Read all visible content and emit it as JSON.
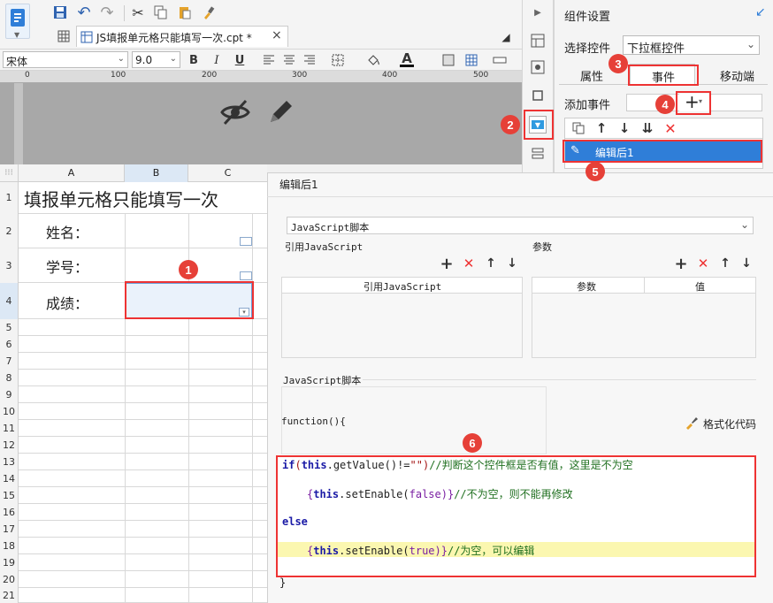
{
  "tab": {
    "title": "JS填报单元格只能填写一次.cpt *",
    "close": "×"
  },
  "font": {
    "family": "宋体",
    "size": "9.0"
  },
  "format_buttons": {
    "bold": "B",
    "italic": "I",
    "underline": "U"
  },
  "ruler": {
    "t0": "0",
    "t100": "100",
    "t200": "200",
    "t300": "300",
    "t400": "400",
    "t500": "500"
  },
  "sheet": {
    "columns": [
      "A",
      "B",
      "C"
    ],
    "rows": [
      "1",
      "2",
      "3",
      "4",
      "5",
      "6",
      "7",
      "8",
      "9",
      "10",
      "11",
      "12",
      "13",
      "14",
      "15",
      "16",
      "17",
      "18",
      "19",
      "20",
      "21"
    ],
    "cells": {
      "title": "填报单元格只能填写一次",
      "name": "姓名：",
      "id": "学号：",
      "score": "成绩："
    }
  },
  "right_panel": {
    "title": "组件设置",
    "select_label": "选择控件",
    "select_value": "下拉框控件",
    "tabs": [
      "属性",
      "事件",
      "移动端"
    ],
    "add_event_label": "添加事件",
    "event_item": "编辑后1"
  },
  "editor": {
    "title": "编辑后1",
    "type_select": "JavaScript脚本",
    "ref_js_label": "引用JavaScript",
    "params_label": "参数",
    "ref_js_header": "引用JavaScript",
    "param_header": "参数",
    "value_header": "值",
    "script_label": "JavaScript脚本",
    "function_head": "function(){",
    "format_code": "格式化代码",
    "closing": "}",
    "code": {
      "l1_kw": "if",
      "l1_a": "(",
      "l1_this": "this",
      "l1_b": ".getValue()!=",
      "l1_str": "\"\"",
      "l1_c": ")",
      "l1_cm": "//判断这个控件框是否有值，这里是不为空",
      "l2_a": "{",
      "l2_this": "this",
      "l2_b": ".setEnable(",
      "l2_val": "false",
      "l2_c": ")}",
      "l2_cm": "//不为空，则不能再修改",
      "l3_kw": "else",
      "l4_a": "{",
      "l4_this": "this",
      "l4_b": ".setEnable(",
      "l4_val": "true",
      "l4_c": ")}",
      "l4_cm": "//为空，可以编辑"
    }
  },
  "badges": [
    "1",
    "2",
    "3",
    "4",
    "5",
    "6"
  ],
  "colors": {
    "accent": "#3a7bd5",
    "annotation": "#e64038",
    "selected_row": "#2f7ed8"
  }
}
